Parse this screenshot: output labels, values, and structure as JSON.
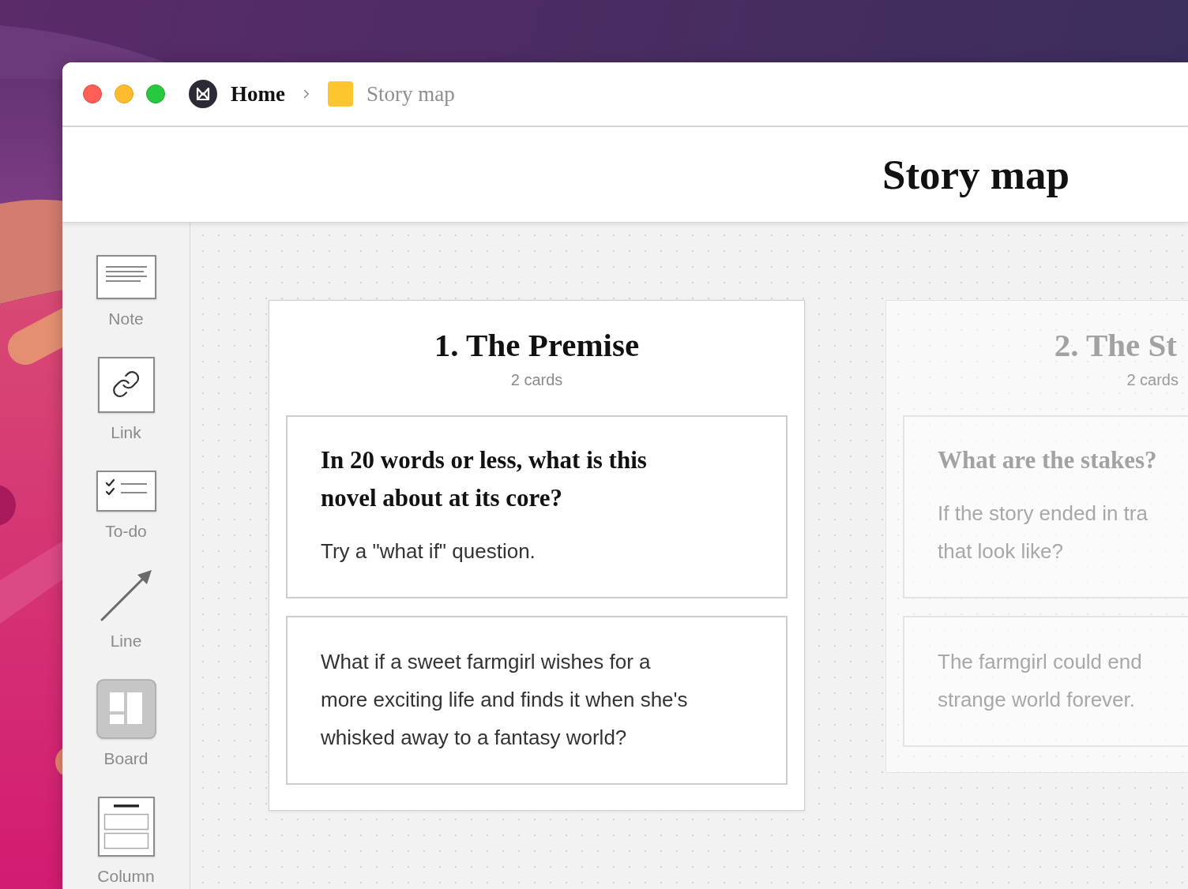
{
  "title_bar": {
    "breadcrumbs": [
      {
        "kind": "home",
        "label": "Home",
        "current": false
      },
      {
        "kind": "board",
        "label": "Story map",
        "current": true
      }
    ]
  },
  "header": {
    "title": "Story map"
  },
  "toolbar": {
    "tools": [
      {
        "kind": "note",
        "label": "Note"
      },
      {
        "kind": "link",
        "label": "Link"
      },
      {
        "kind": "todo",
        "label": "To-do"
      },
      {
        "kind": "line",
        "label": "Line"
      },
      {
        "kind": "board",
        "label": "Board"
      },
      {
        "kind": "column",
        "label": "Column"
      }
    ]
  },
  "canvas": {
    "columns": [
      {
        "title": "1. The Premise",
        "count": "2 cards",
        "dimmed": false,
        "cards": [
          {
            "title_lines": [
              "In 20 words or less, what is this",
              "novel about at its core?"
            ],
            "body_lines": [
              "Try a \"what if\" question."
            ]
          },
          {
            "body_lines": [
              "What if a sweet farmgirl wishes for a",
              "more exciting life and finds it when she's",
              "whisked away to a fantasy world?"
            ]
          }
        ]
      },
      {
        "title": "2. The St",
        "count": "2 cards",
        "dimmed": true,
        "cards": [
          {
            "title_lines": [
              "What are the stakes?"
            ],
            "body_lines": [
              "If the story ended in tra",
              "that look like?"
            ]
          },
          {
            "body_lines": [
              "The farmgirl could end",
              "strange world forever."
            ]
          }
        ]
      }
    ]
  }
}
